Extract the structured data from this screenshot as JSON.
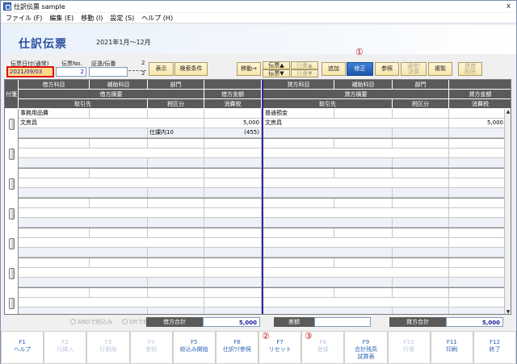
{
  "window": {
    "title": "仕訳伝票 sample",
    "close": "x"
  },
  "menu": [
    {
      "label": "ファイル (F)"
    },
    {
      "label": "編集 (E)"
    },
    {
      "label": "移動 (I)"
    },
    {
      "label": "設定 (S)"
    },
    {
      "label": "ヘルプ (H)"
    }
  ],
  "header": {
    "title": "仕訳伝票",
    "period": "2021年1月～12月"
  },
  "fields": {
    "date_label": "伝票日付(通常)",
    "date_value": "2021/09/03",
    "no_label": "伝票No.",
    "no_value": "2",
    "voucher_label": "証憑/伝番",
    "voucher_value": "",
    "count_top": "2",
    "count_bottom": "2"
  },
  "toolbar": {
    "display": "表示",
    "search": "検索条件",
    "move": "移動→",
    "voucher_up": "伝票▲",
    "voucher_down": "伝票▼",
    "row_up": "行番▲",
    "row_down": "行番▼",
    "add": "追加",
    "modify": "修正",
    "reference": "参照",
    "carry1": "通常/",
    "carry2": "決算",
    "copy": "複製",
    "delete1": "貸借",
    "delete2": "削除"
  },
  "annotations": {
    "c1": "①",
    "c2": "②",
    "c3": "③"
  },
  "grid": {
    "tab_header": "付箋",
    "debit_headers": {
      "account": "借方科目",
      "sub": "補助科目",
      "dept": "部門",
      "summary": "借方摘要",
      "amount": "借方金額",
      "partner": "取引先",
      "tax_class": "税区分",
      "tax": "消費税"
    },
    "credit_headers": {
      "account": "貸方科目",
      "sub": "補助科目",
      "dept": "部門",
      "summary": "貸方摘要",
      "amount": "貸方金額",
      "partner": "取引先",
      "tax_class": "税区分",
      "tax": "消費税"
    },
    "entries": [
      {
        "d_account": "事務用品費",
        "d_summary": "文房具",
        "d_amount": "5,000",
        "d_tax_class": "仕課内10",
        "d_tax": "(455)",
        "c_account": "普通預金",
        "c_summary": "文房具",
        "c_amount": "5,000"
      }
    ]
  },
  "footer": {
    "and_filter": "ANDで絞込み",
    "or_filter": "ORで絞込み",
    "debit_total_label": "借方合計",
    "debit_total": "5,000",
    "diff_label": "差額",
    "diff": "",
    "credit_total_label": "貸方合計",
    "credit_total": "5,000"
  },
  "fkeys": [
    {
      "key": "F1",
      "label": "ヘルプ",
      "enabled": true
    },
    {
      "key": "F2",
      "label": "行挿入",
      "enabled": false
    },
    {
      "key": "F3",
      "label": "行削除",
      "enabled": false
    },
    {
      "key": "F4",
      "label": "参照",
      "enabled": false
    },
    {
      "key": "F5",
      "label": "絞込み開始",
      "enabled": true
    },
    {
      "key": "F6",
      "label": "仕訳ﾜｸ参照",
      "enabled": true
    },
    {
      "key": "F7",
      "label": "リセット",
      "enabled": true
    },
    {
      "key": "F8",
      "label": "登録",
      "enabled": false
    },
    {
      "key": "F9",
      "label": "合計残高\n試算表",
      "enabled": true
    },
    {
      "key": "F10",
      "label": "行複",
      "enabled": false
    },
    {
      "key": "F11",
      "label": "印刷",
      "enabled": true
    },
    {
      "key": "F12",
      "label": "終了",
      "enabled": true
    }
  ]
}
